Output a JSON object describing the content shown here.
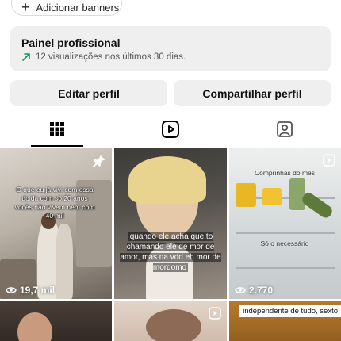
{
  "banner": {
    "label": "Adicionar banners"
  },
  "panel": {
    "title": "Painel profissional",
    "subtitle": "12 visualizações nos últimos 30 dias."
  },
  "buttons": {
    "edit": "Editar perfil",
    "share": "Compartilhar perfil"
  },
  "tabs": [
    {
      "icon": "grid-icon",
      "active": true
    },
    {
      "icon": "reels-icon",
      "active": false
    },
    {
      "icon": "tagged-icon",
      "active": false
    }
  ],
  "posts": [
    {
      "caption": "O que eu já vivi com essa doida com só 20 anos vocês não vivem nem com 40 mil",
      "views": "19,7 mil",
      "pinned": true
    },
    {
      "caption": "quando ele acha que to chamando ele de mor de amor, mas na vdd eh mor de mordomo",
      "views": "",
      "pinned": false
    },
    {
      "caption_top": "Comprinhas do mês",
      "caption_mid": "Só o necessário",
      "views": "2.770",
      "type": "reel"
    },
    {
      "caption": "",
      "views": ""
    },
    {
      "caption": "",
      "views": "",
      "type": "reel"
    },
    {
      "caption": "independente de tudo, sexto",
      "views": ""
    }
  ],
  "colors": {
    "accent_green": "#0a9b5a",
    "tab_underline": "#000000"
  }
}
